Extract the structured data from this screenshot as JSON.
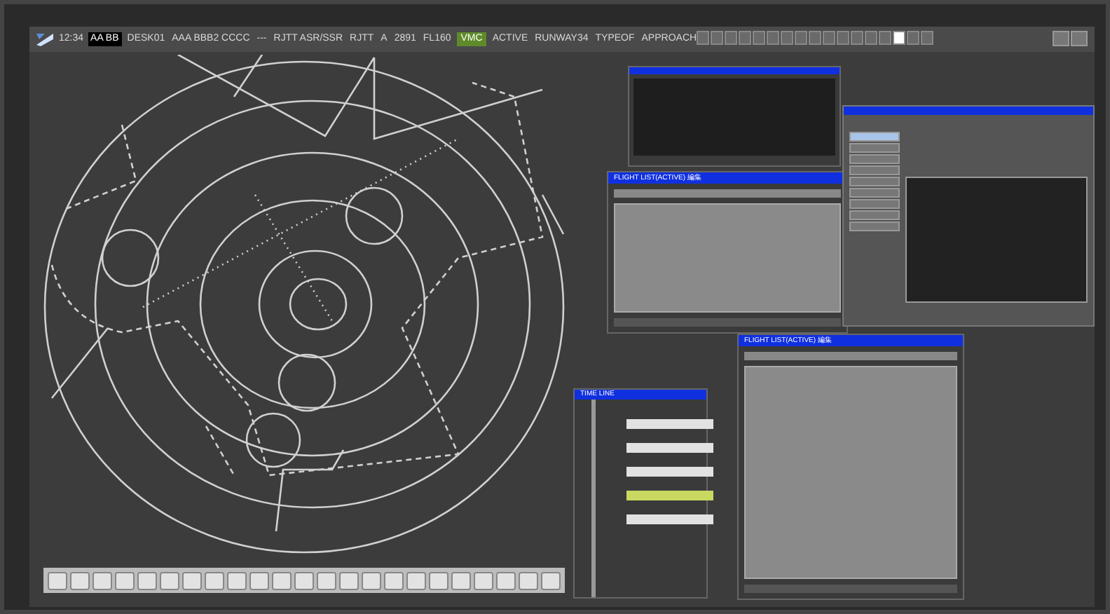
{
  "top_bar": {
    "time": "12:34",
    "items": [
      {
        "text": "AA BB",
        "kind": "badge"
      },
      {
        "text": "DESK01",
        "kind": "plain"
      },
      {
        "text": "AAA BBB2 CCCC",
        "kind": "plain"
      },
      {
        "text": "---",
        "kind": "plain"
      },
      {
        "text": "RJTT ASR/SSR",
        "kind": "plain"
      },
      {
        "text": "RJTT",
        "kind": "plain"
      },
      {
        "text": "A",
        "kind": "plain"
      },
      {
        "text": "2891",
        "kind": "plain"
      },
      {
        "text": "FL160",
        "kind": "plain"
      },
      {
        "text": "VMC",
        "kind": "status"
      },
      {
        "text": "ACTIVE",
        "kind": "plain"
      },
      {
        "text": "RUNWAY34",
        "kind": "plain"
      },
      {
        "text": "TYPEOF",
        "kind": "plain"
      },
      {
        "text": "APPROACH",
        "kind": "plain"
      }
    ]
  },
  "flight_lists": [
    {
      "title": "FLIGHT LIST(ACTIVE) 編集"
    },
    {
      "title": "FLIGHT LIST(ACTIVE) 編集"
    }
  ],
  "timeline": {
    "title": "TIME LINE",
    "tags": [
      {
        "selected": false
      },
      {
        "selected": false
      },
      {
        "selected": false
      },
      {
        "selected": true
      },
      {
        "selected": false
      }
    ]
  },
  "detail_panel": {
    "menu": [
      {
        "selected": true
      },
      {
        "selected": false
      },
      {
        "selected": false
      },
      {
        "selected": false
      },
      {
        "selected": false
      },
      {
        "selected": false
      },
      {
        "selected": false
      },
      {
        "selected": false
      },
      {
        "selected": false
      }
    ]
  }
}
